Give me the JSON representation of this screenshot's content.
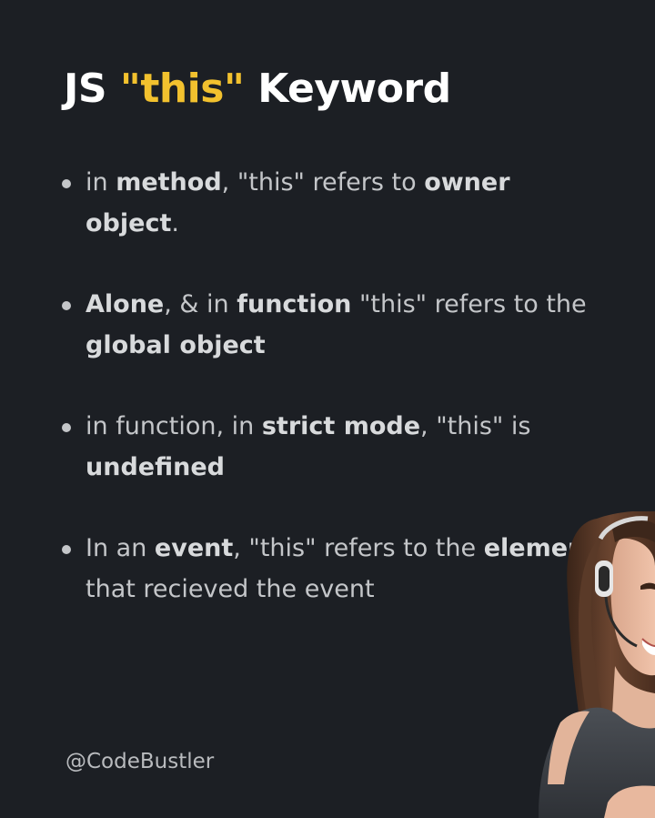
{
  "title": {
    "prefix": "JS ",
    "highlight": "\"this\"",
    "suffix": " Keyword"
  },
  "bullets": [
    {
      "segments": [
        {
          "text": "in ",
          "bold": false
        },
        {
          "text": "method",
          "bold": true
        },
        {
          "text": ", \"this\" refers to ",
          "bold": false
        },
        {
          "text": "owner object",
          "bold": true
        },
        {
          "text": ".",
          "bold": false
        }
      ]
    },
    {
      "segments": [
        {
          "text": "Alone",
          "bold": true
        },
        {
          "text": ", & in ",
          "bold": false
        },
        {
          "text": "function",
          "bold": true
        },
        {
          "text": " \"this\" refers to the ",
          "bold": false
        },
        {
          "text": "global object",
          "bold": true
        }
      ]
    },
    {
      "segments": [
        {
          "text": "in function, in ",
          "bold": false
        },
        {
          "text": "strict mode",
          "bold": true
        },
        {
          "text": ", \"this\" is ",
          "bold": false
        },
        {
          "text": "undefined",
          "bold": true
        }
      ]
    },
    {
      "segments": [
        {
          "text": "In an ",
          "bold": false
        },
        {
          "text": "event",
          "bold": true
        },
        {
          "text": ", \"this\" refers to the ",
          "bold": false
        },
        {
          "text": "element",
          "bold": true
        },
        {
          "text": " that recieved the event",
          "bold": false
        }
      ]
    }
  ],
  "footer": {
    "handle": "@CodeBustler"
  },
  "colors": {
    "background": "#1c1f24",
    "title": "#ffffff",
    "accent": "#f2c12e",
    "body_text": "#c4c6c9"
  },
  "image": {
    "icon": "woman-with-headset-photo"
  }
}
